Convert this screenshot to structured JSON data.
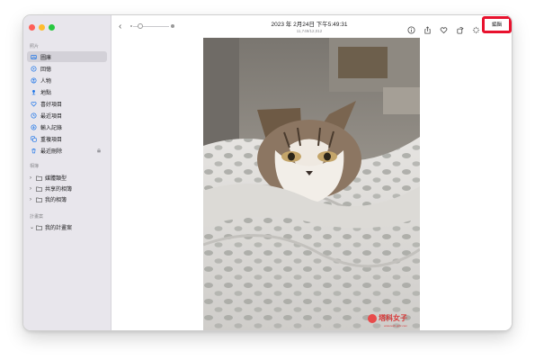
{
  "sidebar": {
    "sections": [
      {
        "title": "照片"
      },
      {
        "title": "相簿"
      },
      {
        "title": "計畫案"
      }
    ],
    "items": [
      {
        "label": "圖庫",
        "icon": "photo-library-icon",
        "selected": true
      },
      {
        "label": "回憶",
        "icon": "memories-icon"
      },
      {
        "label": "人物",
        "icon": "people-icon"
      },
      {
        "label": "地點",
        "icon": "places-icon"
      },
      {
        "label": "喜好項目",
        "icon": "heart-icon"
      },
      {
        "label": "最近項目",
        "icon": "clock-icon"
      },
      {
        "label": "輸入記錄",
        "icon": "import-icon"
      },
      {
        "label": "重複項目",
        "icon": "duplicates-icon"
      },
      {
        "label": "最近刪除",
        "icon": "trash-icon",
        "locked": true
      }
    ],
    "albums": [
      {
        "label": "媒體類型",
        "expanded": false
      },
      {
        "label": "共享的相簿",
        "expanded": false
      },
      {
        "label": "我的相簿",
        "expanded": false
      }
    ],
    "projects": [
      {
        "label": "我的計畫案",
        "expanded": true
      }
    ]
  },
  "toolbar": {
    "title": "2023 年 2月24日 下午5:49:31",
    "subtitle": "11,749/12,012",
    "edit_label": "編輯",
    "icons": [
      "info-icon",
      "share-icon",
      "heart-icon",
      "rotate-icon",
      "enhance-icon"
    ]
  },
  "photo": {
    "watermark": "塔科女子",
    "watermark_url": "www.tech-girlz.com"
  },
  "colors": {
    "highlight": "#e8122e",
    "sidebar_bg": "#e8e6ec",
    "accent": "#1a73e8"
  }
}
